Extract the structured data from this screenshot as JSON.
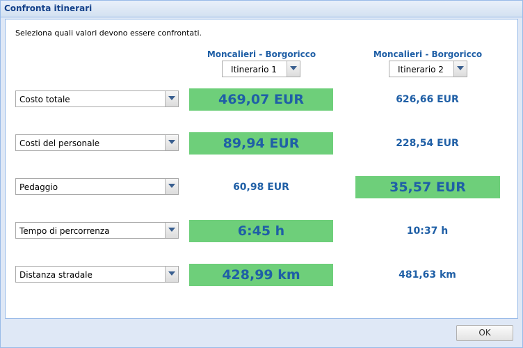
{
  "dialog": {
    "title": "Confronta itinerari",
    "intro": "Seleziona quali valori devono essere confrontati.",
    "ok_label": "OK"
  },
  "columns": [
    {
      "route": "Moncalieri - Borgoricco",
      "selected": "Itinerario 1"
    },
    {
      "route": "Moncalieri - Borgoricco",
      "selected": "Itinerario 2"
    }
  ],
  "rows": [
    {
      "criterion": "Costo totale",
      "values": [
        "469,07 EUR",
        "626,66 EUR"
      ],
      "best": 0
    },
    {
      "criterion": "Costi del personale",
      "values": [
        "89,94 EUR",
        "228,54 EUR"
      ],
      "best": 0
    },
    {
      "criterion": "Pedaggio",
      "values": [
        "60,98 EUR",
        "35,57 EUR"
      ],
      "best": 1
    },
    {
      "criterion": "Tempo di percorrenza",
      "values": [
        "6:45 h",
        "10:37 h"
      ],
      "best": 0
    },
    {
      "criterion": "Distanza stradale",
      "values": [
        "428,99 km",
        "481,63 km"
      ],
      "best": 0
    }
  ],
  "colors": {
    "best_highlight": "#6ecf7a",
    "value_text": "#1f5fa6",
    "title_text": "#15428b"
  },
  "icons": {
    "dropdown": "chevron-down-icon"
  }
}
